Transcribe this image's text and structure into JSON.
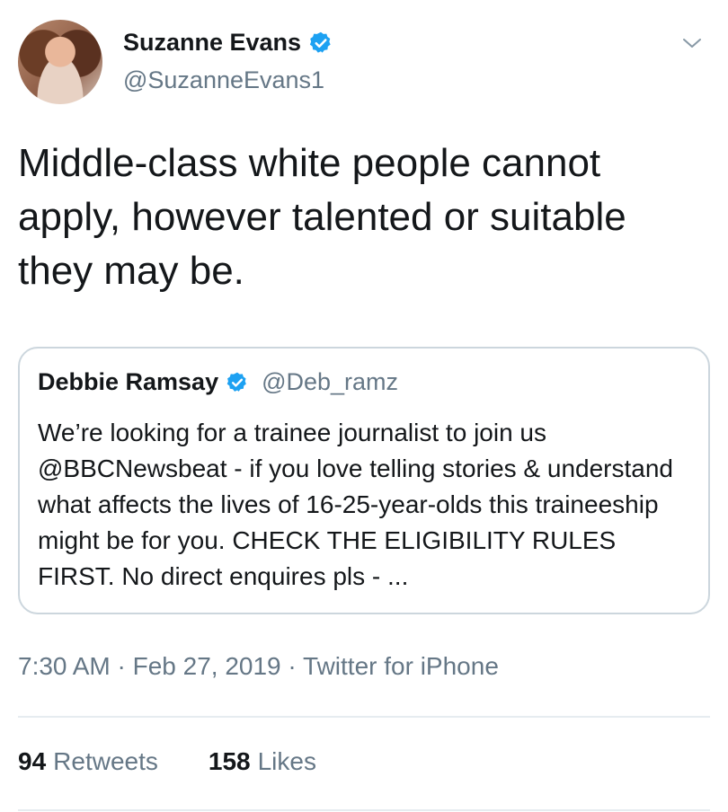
{
  "tweet": {
    "author": {
      "name": "Suzanne Evans",
      "handle": "@SuzanneEvans1",
      "verified": true
    },
    "text": "Middle-class white people cannot apply, however talented or suitable they may be.",
    "timestamp": "7:30 AM · Feb 27, 2019 · Twitter for iPhone",
    "stats": {
      "retweets_count": "94",
      "retweets_label": "Retweets",
      "likes_count": "158",
      "likes_label": "Likes"
    }
  },
  "quoted_tweet": {
    "author": {
      "name": "Debbie Ramsay",
      "handle": "@Deb_ramz",
      "verified": true
    },
    "text": "We’re looking for a trainee journalist to join us @BBCNewsbeat - if you love telling stories & understand what affects the lives of 16-25-year-olds this traineeship might be for you. CHECK THE ELIGIBILITY RULES FIRST. No direct enquires pls - ..."
  },
  "icons": {
    "verified": "verified-badge-icon",
    "menu": "chevron-down-icon"
  },
  "colors": {
    "verified_blue": "#1da1f2",
    "secondary_text": "#657786",
    "border": "#ccd6dd"
  }
}
